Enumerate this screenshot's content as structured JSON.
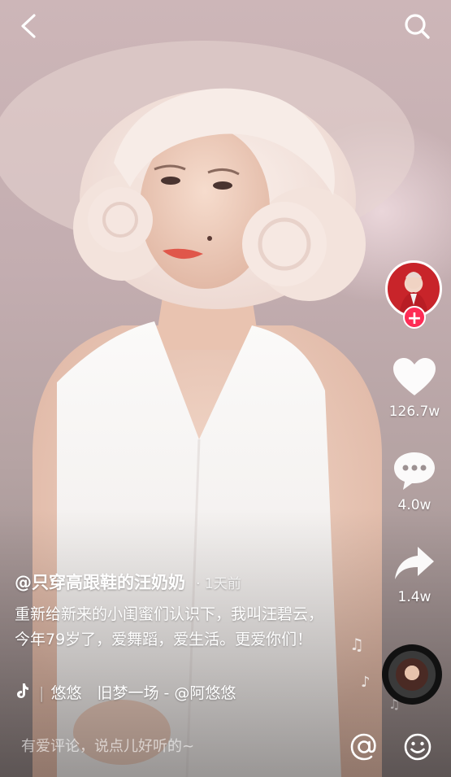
{
  "top_bar": {
    "back_icon": "chevron-left-icon",
    "search_icon": "search-icon"
  },
  "creator": {
    "handle": "@只穿高跟鞋的汪奶奶",
    "post_time": "· 1天前",
    "follow_symbol": "+"
  },
  "caption": {
    "text": "重新给新来的小闺蜜们认识下，我叫汪碧云，今年79岁了，爱舞蹈，爱生活。更爱你们！"
  },
  "music": {
    "icon": "tiktok-note-icon",
    "separator": "|",
    "title": "悠悠　旧梦一场 - @阿悠悠"
  },
  "actions": {
    "likes": "126.7w",
    "comments": "4.0w",
    "shares": "1.4w"
  },
  "comment_bar": {
    "placeholder": "有爱评论，说点儿好听的~",
    "at_symbol": "@"
  },
  "colors": {
    "follow_badge": "#fe2c55",
    "avatar_background": "#c8242a",
    "icon": "#ffffff"
  }
}
